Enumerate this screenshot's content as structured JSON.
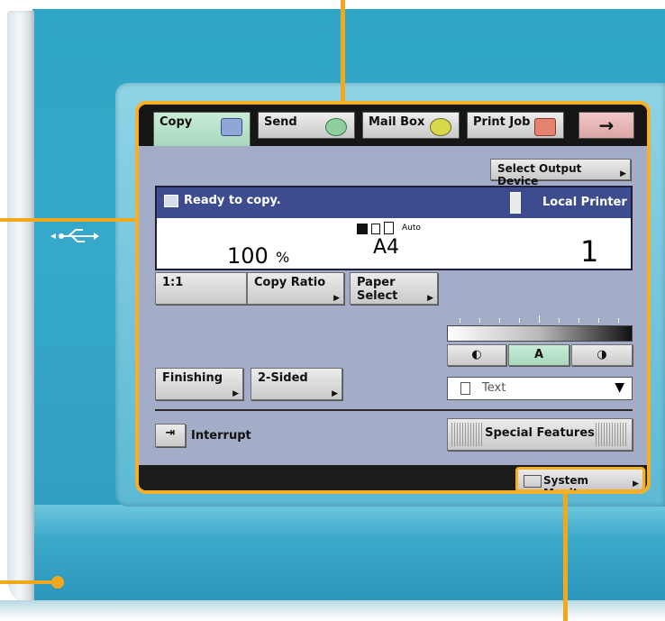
{
  "tabs": [
    {
      "label": "Copy",
      "icon": "copy-icon"
    },
    {
      "label": "Send",
      "icon": "send-icon"
    },
    {
      "label": "Mail Box",
      "icon": "mailbox-icon"
    },
    {
      "label": "Print Job",
      "icon": "printjob-icon"
    },
    {
      "label": "→",
      "icon": "arrow-right-icon"
    }
  ],
  "output_device_label": "Select Output Device",
  "status": {
    "message": "Ready to copy.",
    "printer": "Local Printer",
    "ratio": "100",
    "ratio_unit": "%",
    "paper_size": "A4",
    "paper_mode": "Auto",
    "copies": "1"
  },
  "buttons": {
    "one_to_one": "1:1",
    "copy_ratio": "Copy Ratio",
    "paper_select": "Paper Select",
    "finishing": "Finishing",
    "two_sided": "2-Sided",
    "interrupt": "Interrupt",
    "special_features": "Special Features",
    "system_monitor": "System Monitor"
  },
  "density": {
    "auto_label": "A",
    "lighter_icon": "half-moon-left-icon",
    "darker_icon": "half-moon-right-icon"
  },
  "image_type": {
    "selected": "Text"
  },
  "colors": {
    "accent": "#f5b027",
    "status_bar": "#3d4b8f",
    "active_tab": "#c9ecd6",
    "screen_bg": "#a3adc8"
  }
}
